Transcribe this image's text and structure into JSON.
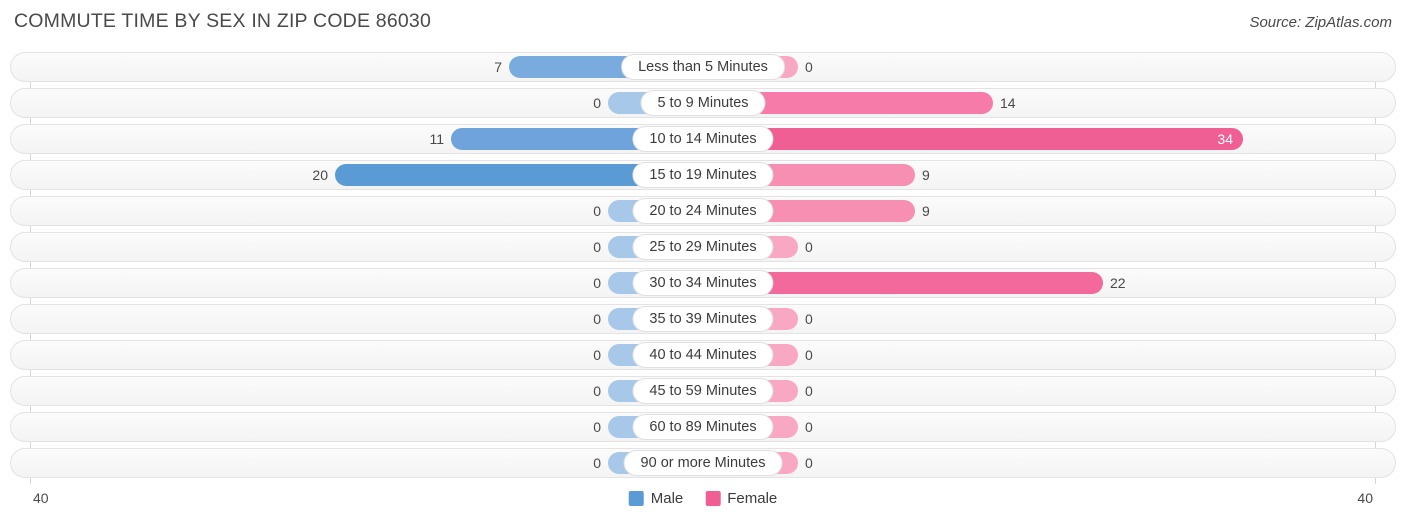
{
  "header": {
    "title": "COMMUTE TIME BY SEX IN ZIP CODE 86030",
    "source": "Source: ZipAtlas.com"
  },
  "legend": {
    "male_label": "Male",
    "female_label": "Female",
    "male_color": "#5b9bd5",
    "female_color": "#ef5f94"
  },
  "axis": {
    "left_max": "40",
    "right_max": "40"
  },
  "chart_data": {
    "type": "bar",
    "title": "COMMUTE TIME BY SEX IN ZIP CODE 86030",
    "subtitle": "",
    "xlabel": "",
    "ylabel": "",
    "orientation": "horizontal-diverging",
    "grid": false,
    "legend_position": "bottom-center",
    "axis_max": 40,
    "axis_left_label": "40",
    "axis_right_label": "40",
    "categories": [
      "Less than 5 Minutes",
      "5 to 9 Minutes",
      "10 to 14 Minutes",
      "15 to 19 Minutes",
      "20 to 24 Minutes",
      "25 to 29 Minutes",
      "30 to 34 Minutes",
      "35 to 39 Minutes",
      "40 to 44 Minutes",
      "45 to 59 Minutes",
      "60 to 89 Minutes",
      "90 or more Minutes"
    ],
    "series": [
      {
        "name": "Male",
        "color": "#5b9bd5",
        "side": "left",
        "values": [
          7,
          0,
          11,
          20,
          0,
          0,
          0,
          0,
          0,
          0,
          0,
          0
        ]
      },
      {
        "name": "Female",
        "color": "#ef5f94",
        "side": "right",
        "values": [
          0,
          14,
          34,
          9,
          9,
          0,
          22,
          0,
          0,
          0,
          0,
          0
        ]
      }
    ]
  },
  "rows": [
    {
      "category": "Less than 5 Minutes",
      "male": "7",
      "female": "0",
      "male_w": 194,
      "female_w": 95,
      "male_color": "#7aabdf",
      "female_color": "#f9a8c4",
      "male_inside": false,
      "female_inside": false
    },
    {
      "category": "5 to 9 Minutes",
      "male": "0",
      "female": "14",
      "male_w": 95,
      "female_w": 290,
      "male_color": "#a8c8ea",
      "female_color": "#f77ba9",
      "male_inside": false,
      "female_inside": false
    },
    {
      "category": "10 to 14 Minutes",
      "male": "11",
      "female": "34",
      "male_w": 252,
      "female_w": 540,
      "male_color": "#6ea3db",
      "female_color": "#ef5f94",
      "male_inside": false,
      "female_inside": true
    },
    {
      "category": "15 to 19 Minutes",
      "male": "20",
      "female": "9",
      "male_w": 368,
      "female_w": 212,
      "male_color": "#5b9bd5",
      "female_color": "#f78fb3",
      "male_inside": false,
      "female_inside": false
    },
    {
      "category": "20 to 24 Minutes",
      "male": "0",
      "female": "9",
      "male_w": 95,
      "female_w": 212,
      "male_color": "#a8c8ea",
      "female_color": "#f78fb3",
      "male_inside": false,
      "female_inside": false
    },
    {
      "category": "25 to 29 Minutes",
      "male": "0",
      "female": "0",
      "male_w": 95,
      "female_w": 95,
      "male_color": "#a8c8ea",
      "female_color": "#f9a8c4",
      "male_inside": false,
      "female_inside": false
    },
    {
      "category": "30 to 34 Minutes",
      "male": "0",
      "female": "22",
      "male_w": 95,
      "female_w": 400,
      "male_color": "#a8c8ea",
      "female_color": "#f4699b",
      "male_inside": false,
      "female_inside": false
    },
    {
      "category": "35 to 39 Minutes",
      "male": "0",
      "female": "0",
      "male_w": 95,
      "female_w": 95,
      "male_color": "#a8c8ea",
      "female_color": "#f9a8c4",
      "male_inside": false,
      "female_inside": false
    },
    {
      "category": "40 to 44 Minutes",
      "male": "0",
      "female": "0",
      "male_w": 95,
      "female_w": 95,
      "male_color": "#a8c8ea",
      "female_color": "#f9a8c4",
      "male_inside": false,
      "female_inside": false
    },
    {
      "category": "45 to 59 Minutes",
      "male": "0",
      "female": "0",
      "male_w": 95,
      "female_w": 95,
      "male_color": "#a8c8ea",
      "female_color": "#f9a8c4",
      "male_inside": false,
      "female_inside": false
    },
    {
      "category": "60 to 89 Minutes",
      "male": "0",
      "female": "0",
      "male_w": 95,
      "female_w": 95,
      "male_color": "#a8c8ea",
      "female_color": "#f9a8c4",
      "male_inside": false,
      "female_inside": false
    },
    {
      "category": "90 or more Minutes",
      "male": "0",
      "female": "0",
      "male_w": 95,
      "female_w": 95,
      "male_color": "#a8c8ea",
      "female_color": "#f9a8c4",
      "male_inside": false,
      "female_inside": false
    }
  ]
}
